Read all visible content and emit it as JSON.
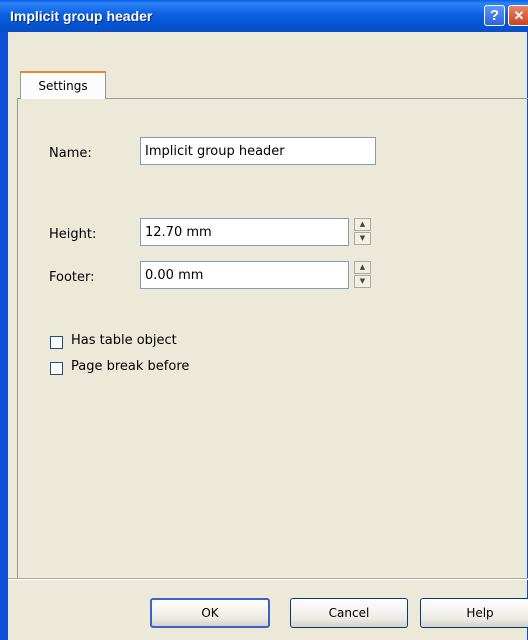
{
  "window": {
    "title": "Implicit group header",
    "help_glyph": "?",
    "close_glyph": "✕"
  },
  "tabs": [
    {
      "label": "Settings",
      "selected": true
    }
  ],
  "form": {
    "name_label": "Name:",
    "name_value": "Implicit group header",
    "height_label": "Height:",
    "height_value": "12.70 mm",
    "footer_label": "Footer:",
    "footer_value": "0.00 mm",
    "has_table_label": "Has table object",
    "has_table_checked": false,
    "page_break_label": "Page break before",
    "page_break_checked": false
  },
  "buttons": {
    "ok": "OK",
    "cancel": "Cancel",
    "help": "Help"
  },
  "colors": {
    "title_bar": "#0553d3",
    "dialog_bg": "#ece9d8",
    "tab_highlight": "#e68b2c"
  }
}
